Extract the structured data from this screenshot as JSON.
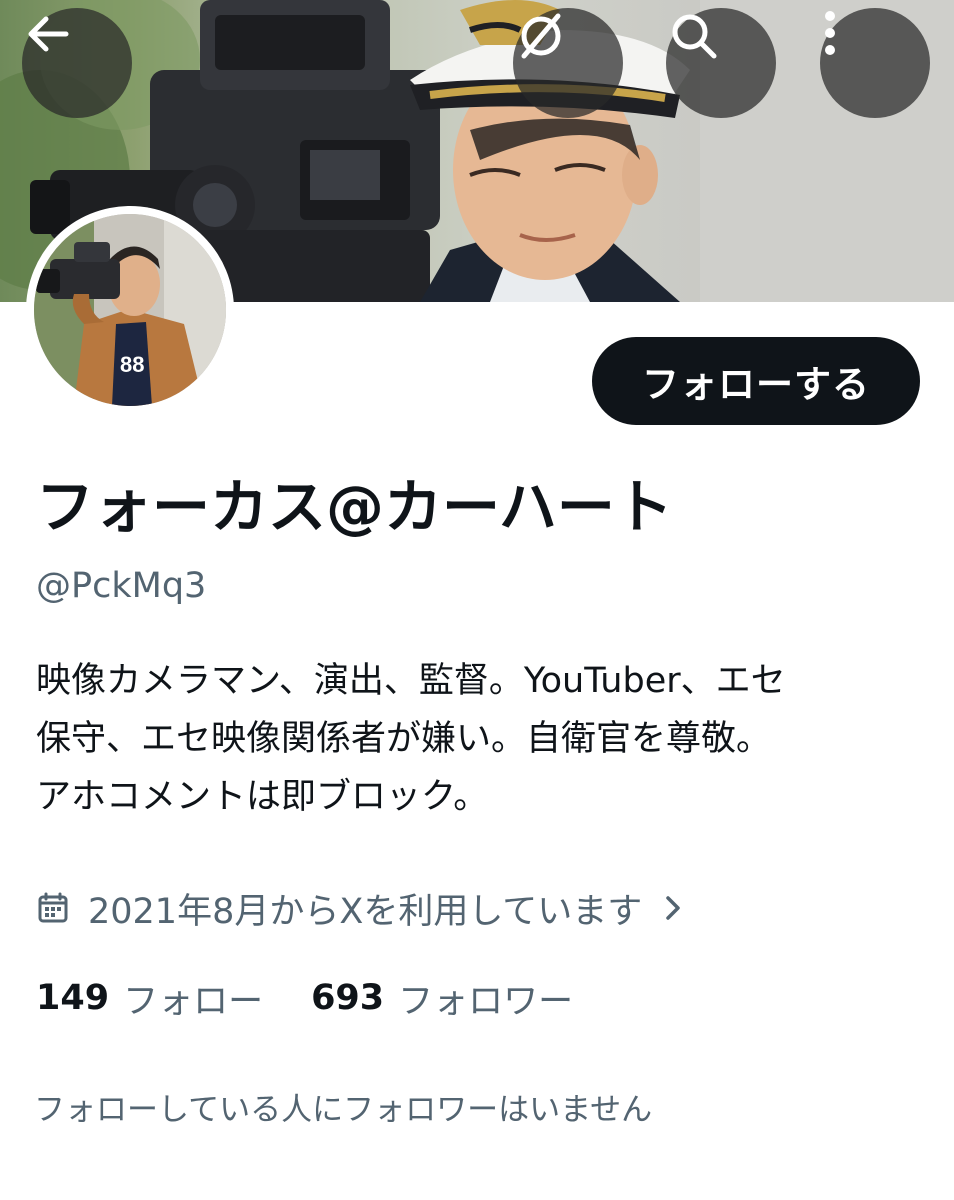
{
  "header": {
    "back_icon": "arrow-left-icon",
    "grok_icon": "grok-slash-icon",
    "search_icon": "search-icon",
    "more_icon": "more-vertical-icon"
  },
  "profile": {
    "follow_label": "フォローする",
    "display_name": "フォーカス@カーハート",
    "handle": "@PckMq3",
    "bio_lines": [
      "映像カメラマン、演出、監督。YouTuber、エセ",
      "保守、エセ映像関係者が嫌い。自衛官を尊敬。",
      "アホコメントは即ブロック。"
    ],
    "joined": "2021年8月からXを利用しています",
    "following_count": "149",
    "following_label": "フォロー",
    "followers_count": "693",
    "followers_label": "フォロワー",
    "mutual_text": "フォローしている人にフォロワーはいません"
  },
  "colors": {
    "primary_text": "#0f1419",
    "secondary_text": "#536471",
    "button_bg": "#0f1419",
    "overlay_button": "#282828"
  }
}
